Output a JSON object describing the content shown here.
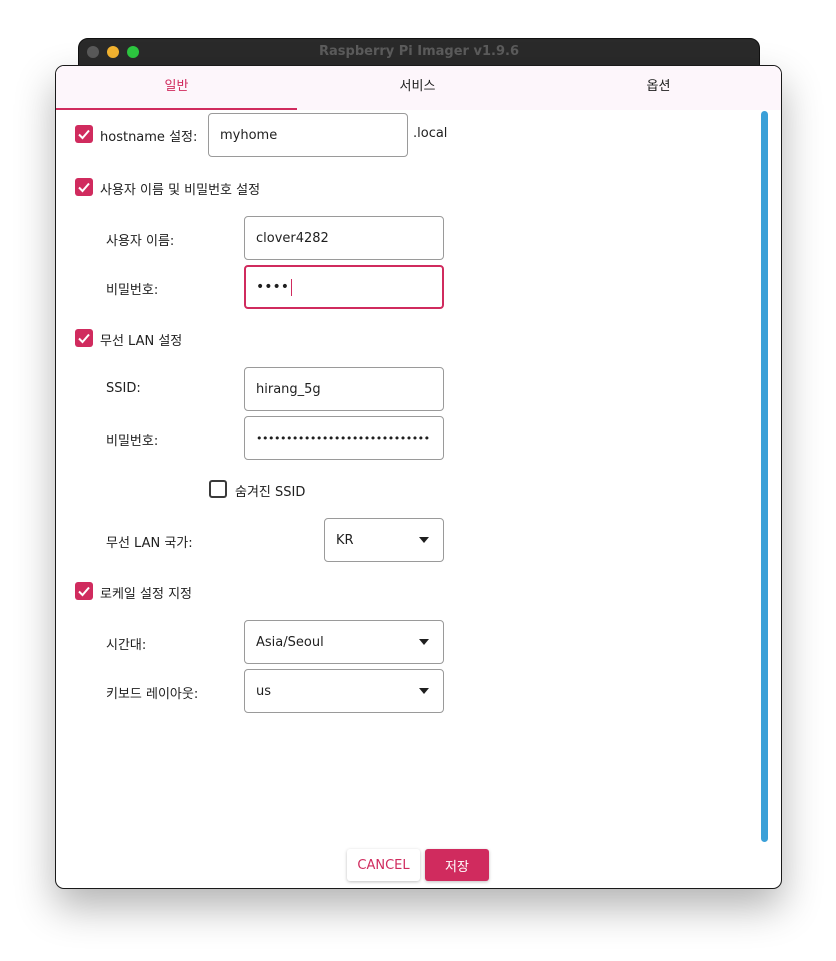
{
  "window": {
    "title": "Raspberry Pi Imager v1.9.6"
  },
  "tabs": [
    {
      "label": "일반",
      "active": true
    },
    {
      "label": "서비스",
      "active": false
    },
    {
      "label": "옵션",
      "active": false
    }
  ],
  "hostname": {
    "checked": true,
    "label": "hostname 설정:",
    "value": "myhome",
    "suffix": ".local"
  },
  "user": {
    "checked": true,
    "label": "사용자 이름 및 비밀번호 설정",
    "username_label": "사용자 이름:",
    "username_value": "clover4282",
    "password_label": "비밀번호:",
    "password_value": "••••"
  },
  "wifi": {
    "checked": true,
    "label": "무선 LAN 설정",
    "ssid_label": "SSID:",
    "ssid_value": "hirang_5g",
    "password_label": "비밀번호:",
    "password_value": "•••••••••••••••••••••••••••••",
    "hidden_checked": false,
    "hidden_label": "숨겨진 SSID",
    "country_label": "무선 LAN 국가:",
    "country_value": "KR"
  },
  "locale": {
    "checked": true,
    "label": "로케일 설정 지정",
    "timezone_label": "시간대:",
    "timezone_value": "Asia/Seoul",
    "keyboard_label": "키보드 레이아웃:",
    "keyboard_value": "us"
  },
  "buttons": {
    "cancel": "CANCEL",
    "save": "저장"
  },
  "colors": {
    "accent": "#d02b5e",
    "scrollbar": "#3aa0d8"
  }
}
